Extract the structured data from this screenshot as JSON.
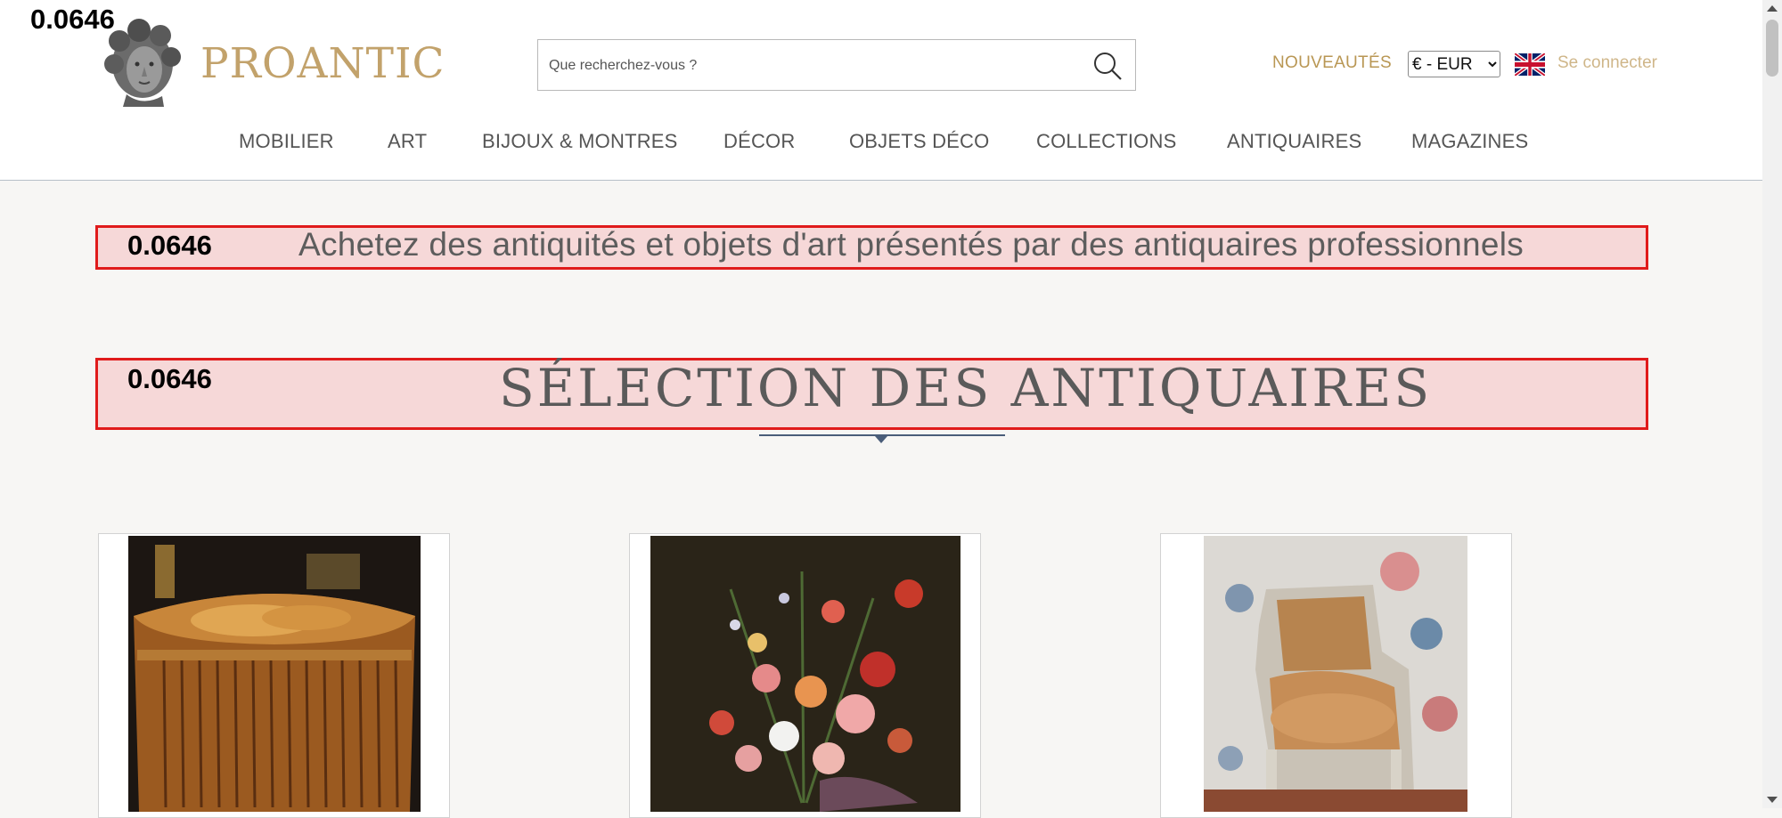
{
  "overlay_scores": [
    "0.0646",
    "0.0646",
    "0.0646"
  ],
  "header": {
    "brand": "PROANTIC",
    "logo_icon": "marble-bust-logo",
    "search": {
      "placeholder": "Que recherchez-vous ?",
      "value": "",
      "icon": "search-icon"
    },
    "nouveautes": "NOUVEAUTÉS",
    "currency": {
      "selected": "€ - EUR",
      "options": [
        "€ - EUR"
      ]
    },
    "language_flag_icon": "uk-flag-icon",
    "login": "Se connecter"
  },
  "nav": {
    "items": [
      {
        "label": "MOBILIER"
      },
      {
        "label": "ART"
      },
      {
        "label": "BIJOUX & MONTRES"
      },
      {
        "label": "DÉCOR"
      },
      {
        "label": "OBJETS DÉCO"
      },
      {
        "label": "COLLECTIONS"
      },
      {
        "label": "ANTIQUAIRES"
      },
      {
        "label": "MAGAZINES"
      }
    ]
  },
  "main": {
    "tagline": "Achetez des antiquités et objets d'art présentés par des antiquaires professionnels",
    "section_title": "SÉLECTION DES ANTIQUAIRES",
    "cards": [
      {
        "image": "marquetry-demilune-commode"
      },
      {
        "image": "floral-still-life-painting"
      },
      {
        "image": "upholstered-bergere-armchair"
      }
    ]
  },
  "colors": {
    "brand_gold": "#c2a26b",
    "nav_text": "#555555",
    "highlight_border": "#e01b1b",
    "highlight_fill": "#f5c4c4",
    "divider": "#4a5d79"
  }
}
